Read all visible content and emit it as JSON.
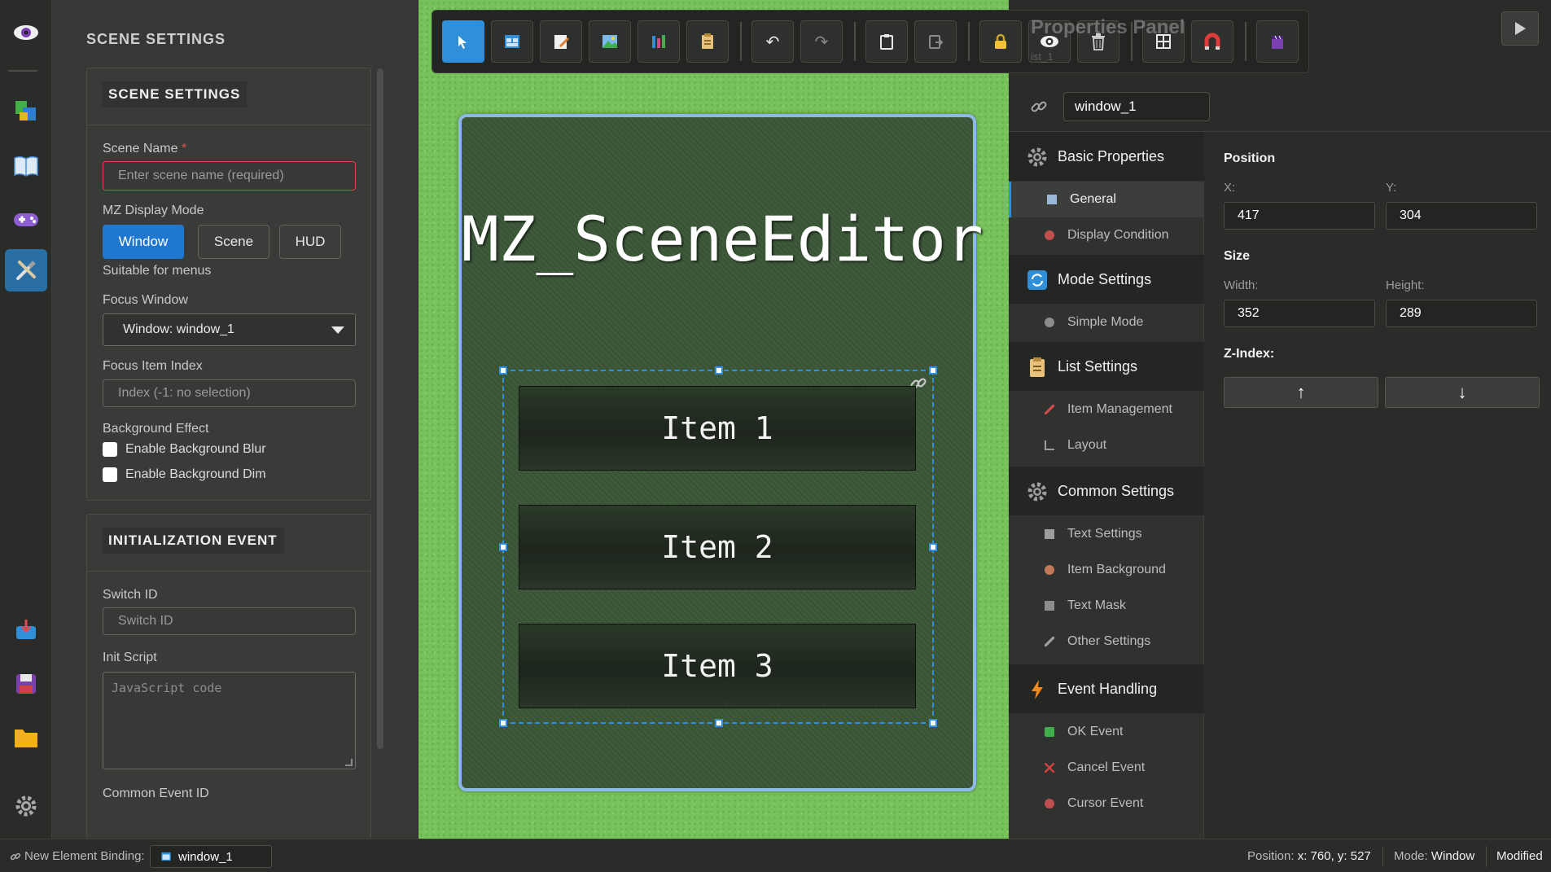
{
  "toolbar": {
    "ghost_title": "Properties Panel",
    "ghost_subtitle": "ist_1",
    "buttons": [
      "select-tool",
      "window-tool",
      "text-tool",
      "image-tool",
      "list-tool",
      "template-tool",
      "undo",
      "redo",
      "copy",
      "paste",
      "lock",
      "visibility",
      "delete",
      "grid",
      "snap",
      "export"
    ]
  },
  "scene_panel": {
    "title": "SCENE SETTINGS",
    "card1_title": "SCENE SETTINGS",
    "scene_name_label": "Scene Name",
    "required_mark": "*",
    "scene_name_placeholder": "Enter scene name (required)",
    "display_mode_label": "MZ Display Mode",
    "modes": [
      "Window",
      "Scene",
      "HUD"
    ],
    "selected_mode": "Window",
    "mode_hint": "Suitable for menus",
    "focus_window_label": "Focus Window",
    "focus_window_value": "Window: window_1",
    "focus_item_label": "Focus Item Index",
    "focus_item_placeholder": "Index (-1: no selection)",
    "background_label": "Background Effect",
    "blur_label": "Enable Background Blur",
    "dim_label": "Enable Background Dim",
    "card2_title": "INITIALIZATION EVENT",
    "switch_label": "Switch ID",
    "switch_placeholder": "Switch ID",
    "init_script_label": "Init Script",
    "init_script_placeholder": "JavaScript code",
    "common_event_label": "Common Event ID"
  },
  "canvas": {
    "title": "MZ_SceneEditor",
    "items": [
      "Item 1",
      "Item 2",
      "Item 3"
    ]
  },
  "properties": {
    "binding_value": "window_1",
    "nav": {
      "basic": "Basic Properties",
      "general": "General",
      "display_condition": "Display Condition",
      "mode": "Mode Settings",
      "simple_mode": "Simple Mode",
      "list": "List Settings",
      "item_management": "Item Management",
      "layout": "Layout",
      "common": "Common Settings",
      "text_settings": "Text Settings",
      "item_background": "Item Background",
      "text_mask": "Text Mask",
      "other_settings": "Other Settings",
      "events": "Event Handling",
      "ok_event": "OK Event",
      "cancel_event": "Cancel Event",
      "cursor_event": "Cursor Event"
    },
    "position_title": "Position",
    "x_label": "X:",
    "x_value": "417",
    "y_label": "Y:",
    "y_value": "304",
    "size_title": "Size",
    "width_label": "Width:",
    "width_value": "352",
    "height_label": "Height:",
    "height_value": "289",
    "zindex_title": "Z-Index:",
    "z_up": "↑",
    "z_down": "↓"
  },
  "statusbar": {
    "binding_label": "New Element Binding:",
    "binding_value": "window_1",
    "position_label": "Position:",
    "position_value": "x: 760, y: 527",
    "mode_label": "Mode:",
    "mode_value": "Window",
    "state": "Modified"
  },
  "colors": {
    "accent": "#1f77d0",
    "canvas_green": "#77c25b",
    "window_fill": "#3f5a3b",
    "selection": "#2f8fe6",
    "error": "#d94a4a"
  }
}
